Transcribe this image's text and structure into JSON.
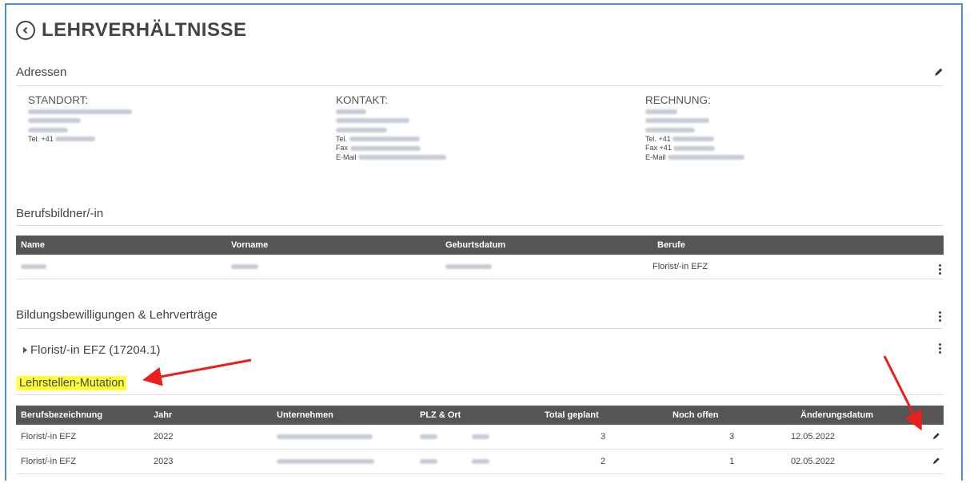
{
  "header": {
    "title": "LEHRVERHÄLTNISSE"
  },
  "adressen": {
    "title": "Adressen",
    "standort": {
      "heading": "STANDORT:",
      "phone_prefix": "Tel. +41"
    },
    "kontakt": {
      "heading": "KONTAKT:",
      "phone_prefix": "Tel.",
      "fax_prefix": "Fax",
      "email_prefix": "E-Mail"
    },
    "rechnung": {
      "heading": "RECHNUNG:",
      "phone_prefix": "Tel. +41",
      "fax_prefix": "Fax +41",
      "email_prefix": "E-Mail"
    }
  },
  "berufsbildner": {
    "title": "Berufsbildner/-in",
    "columns": [
      "Name",
      "Vorname",
      "Geburtsdatum",
      "Berufe"
    ],
    "rows": [
      {
        "berufe": "Florist/-in EFZ"
      }
    ]
  },
  "bildung": {
    "title": "Bildungsbewilligungen & Lehrverträge",
    "item": "Florist/-in EFZ (17204.1)"
  },
  "mutation": {
    "title": "Lehrstellen-Mutation",
    "columns": [
      "Berufsbezeichnung",
      "Jahr",
      "Unternehmen",
      "PLZ & Ort",
      "Total geplant",
      "Noch offen",
      "Änderungsdatum"
    ],
    "rows": [
      {
        "beruf": "Florist/-in EFZ",
        "jahr": "2022",
        "total": "3",
        "offen": "3",
        "datum": "12.05.2022"
      },
      {
        "beruf": "Florist/-in EFZ",
        "jahr": "2023",
        "total": "2",
        "offen": "1",
        "datum": "02.05.2022"
      }
    ]
  },
  "colors": {
    "header_bg": "#555555",
    "highlight": "#ffff33",
    "arrow": "#e8201c",
    "frame": "#4d8fd6"
  },
  "icons": [
    "back-icon",
    "pencil-icon",
    "kebab-icon",
    "caret-right-icon",
    "arrow-annotation"
  ]
}
